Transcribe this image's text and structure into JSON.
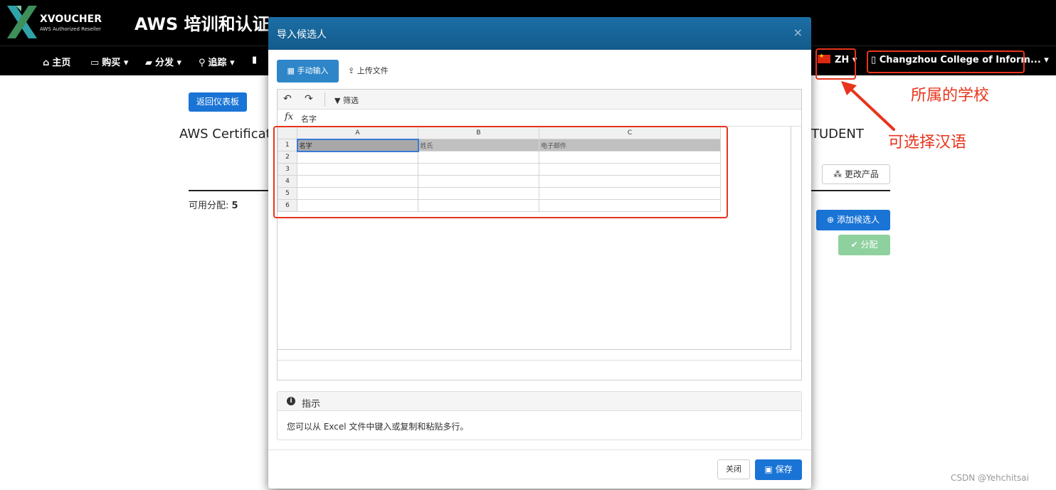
{
  "header": {
    "logo_name": "XVOUCHER",
    "logo_sub": "AWS Authorized Reseller",
    "title": "AWS 培训和认证"
  },
  "nav": {
    "items": [
      {
        "label": "主页",
        "icon": "home-icon"
      },
      {
        "label": "购买",
        "icon": "card-icon"
      },
      {
        "label": "分发",
        "icon": "truck-icon"
      },
      {
        "label": "追踪",
        "icon": "search-icon"
      }
    ],
    "lang": "ZH",
    "school": "Changzhou College of Inform..."
  },
  "annotations": {
    "school_label": "所属的学校",
    "lang_label": "可选择汉语"
  },
  "page": {
    "back_button": "返回仪表板",
    "heading_left": "AWS Certificat",
    "heading_right": "TUDENT",
    "available_label": "可用分配:",
    "available_value": "5",
    "change_product": "更改产品",
    "add_candidate": "添加候选人",
    "assign": "分配"
  },
  "modal": {
    "title": "导入候选人",
    "tab_manual": "手动输入",
    "tab_upload": "上传文件",
    "filter": "筛选",
    "formula_value": "名字",
    "columns": [
      "A",
      "B",
      "C"
    ],
    "rows": [
      [
        "名字",
        "姓氏",
        "电子邮件"
      ],
      [
        "",
        "",
        ""
      ],
      [
        "",
        "",
        ""
      ],
      [
        "",
        "",
        ""
      ],
      [
        "",
        "",
        ""
      ],
      [
        "",
        "",
        ""
      ]
    ],
    "instructions_title": "指示",
    "instructions_text": "您可以从 Excel 文件中键入或复制和粘贴多行。",
    "close_button": "关闭",
    "save_button": "保存"
  },
  "watermark": "CSDN @Yehchitsai",
  "colors": {
    "accent": "#1a74d6",
    "annotation": "#e8341c",
    "modal_header": "#135a8b"
  }
}
